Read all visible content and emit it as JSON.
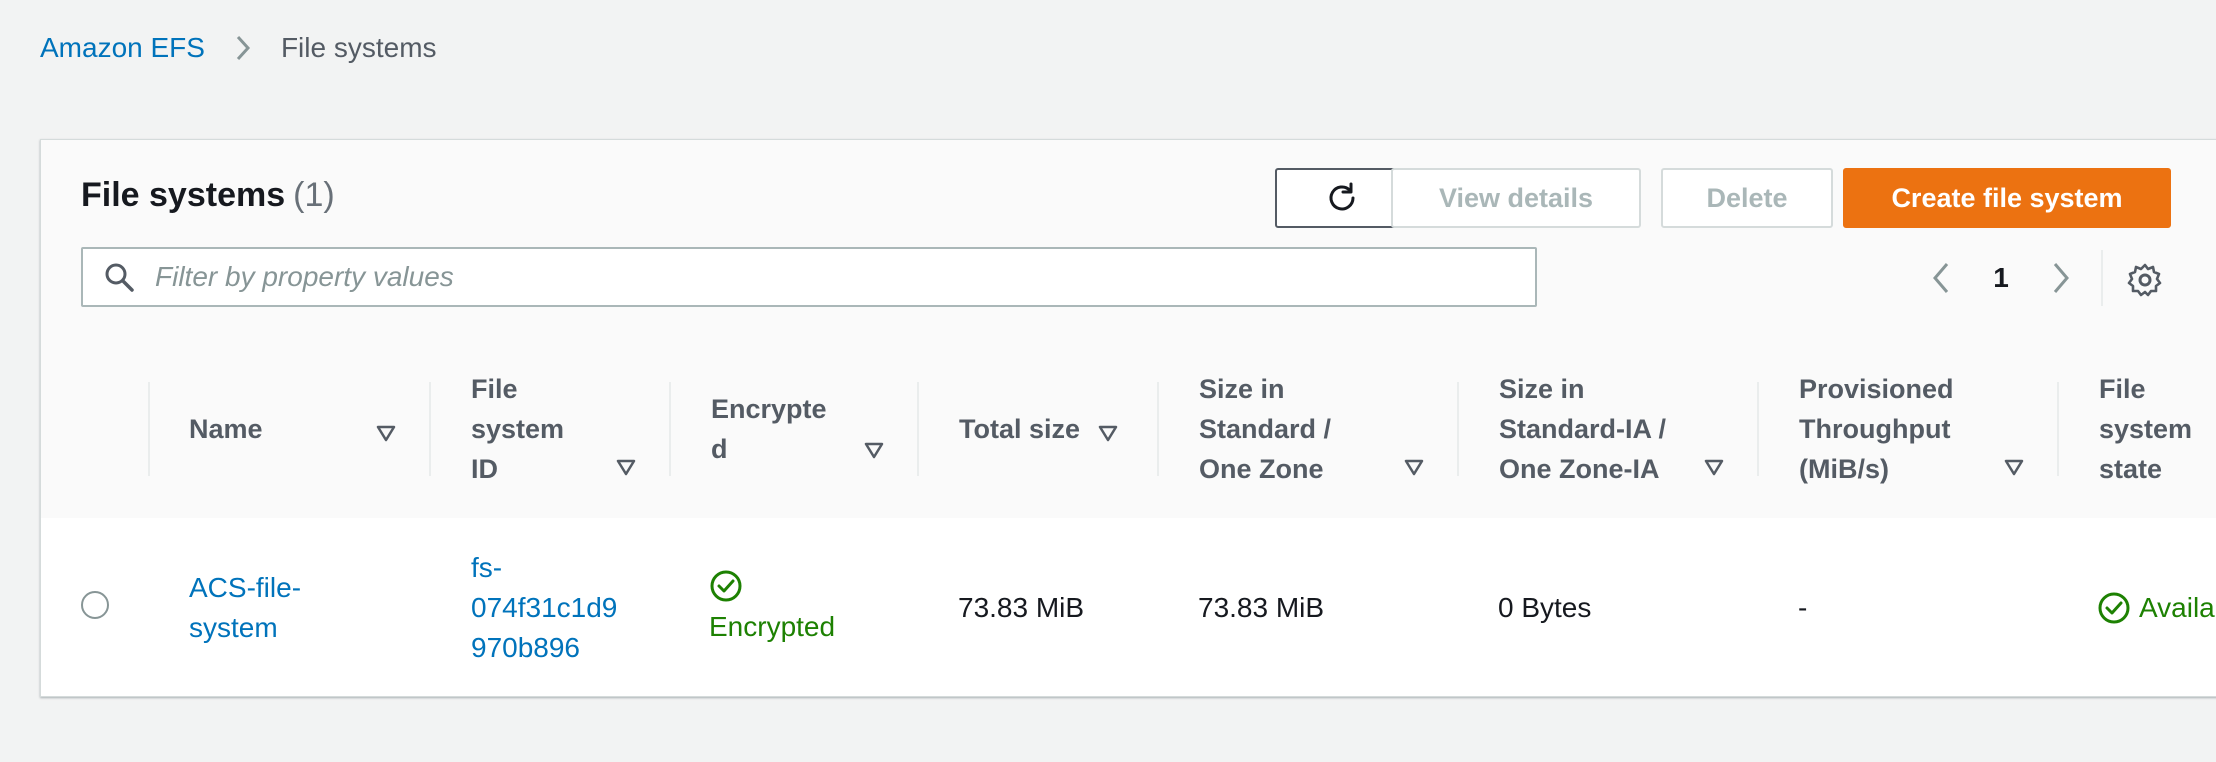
{
  "breadcrumb": {
    "root": "Amazon EFS",
    "current": "File systems"
  },
  "panel": {
    "title": "File systems",
    "count": "(1)"
  },
  "toolbar": {
    "view_details": "View details",
    "delete": "Delete",
    "create": "Create file system"
  },
  "filter": {
    "placeholder": "Filter by property values",
    "value": ""
  },
  "pagination": {
    "current_page": "1"
  },
  "table": {
    "columns": [
      "Name",
      "File\nsystem\nID",
      "Encrypte\nd",
      "Total size",
      "Size in\nStandard /\nOne Zone",
      "Size in\nStandard-IA /\nOne Zone-IA",
      "Provisioned\nThroughput\n(MiB/s)",
      "File\nsystem\nstate"
    ],
    "rows": [
      {
        "name": "ACS-file-\nsystem",
        "id": "fs-\n074f31c1d9\n970b896",
        "encrypted": "Encrypted",
        "total_size": "73.83 MiB",
        "size_standard": "73.83 MiB",
        "size_ia": "0 Bytes",
        "throughput": "-",
        "state": "Available"
      }
    ]
  },
  "colors": {
    "accent": "#ec7211",
    "link": "#0073bb",
    "success": "#1d8102"
  },
  "icons": {
    "refresh": "refresh-icon",
    "search": "search-icon",
    "prev": "chevron-left-icon",
    "next": "chevron-right-icon",
    "settings": "gear-icon",
    "sort": "caret-down-icon",
    "status_ok": "check-circle-icon"
  }
}
